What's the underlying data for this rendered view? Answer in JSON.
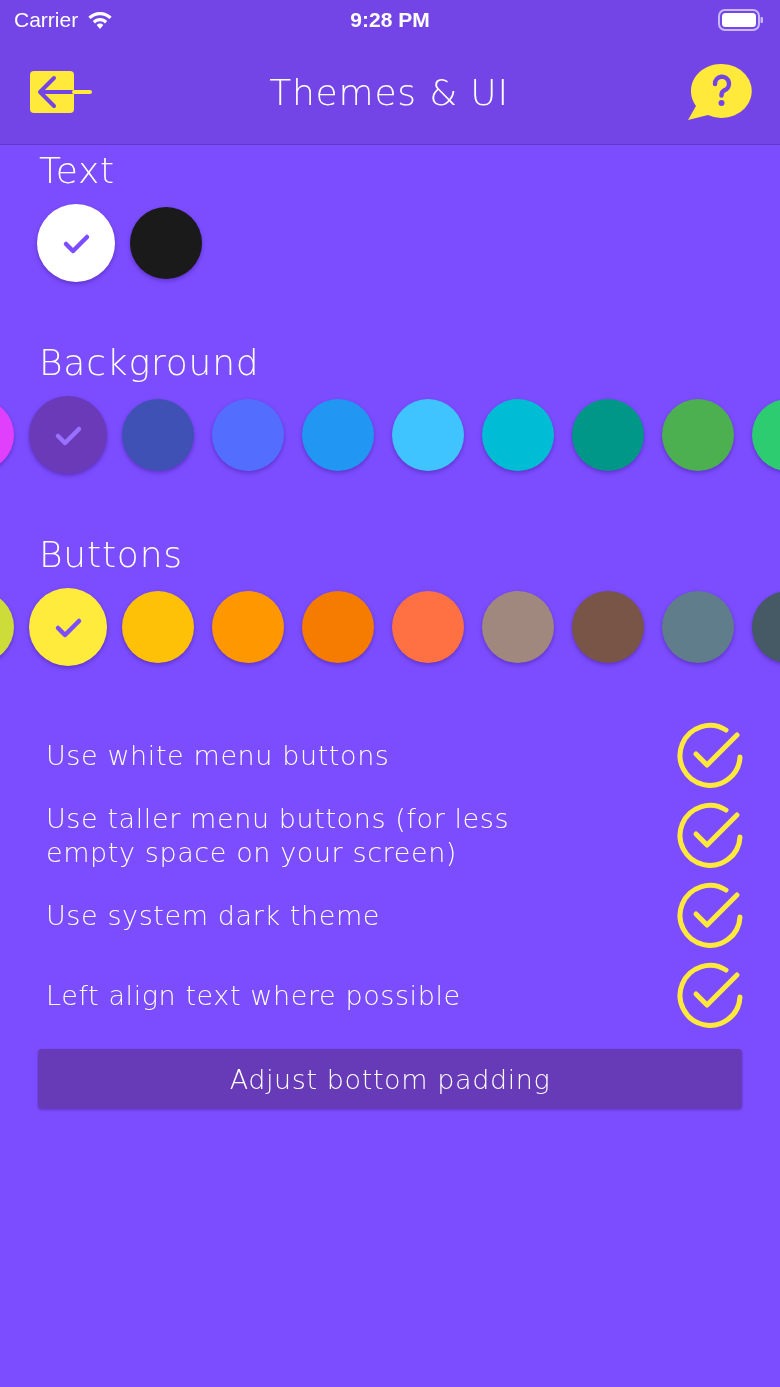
{
  "status_bar": {
    "carrier": "Carrier",
    "time": "9:28 PM"
  },
  "nav": {
    "title": "Themes & UI"
  },
  "palettes": [
    {
      "label": "Text",
      "swatches": [
        {
          "color": "#ffffff",
          "selected": true
        },
        {
          "color": "#1a1a1a",
          "selected": false
        }
      ]
    },
    {
      "label": "Background",
      "swatches": [
        {
          "color": "#e040fb",
          "selected": false
        },
        {
          "color": "#6a3ab8",
          "selected": true
        },
        {
          "color": "#3f51b5",
          "selected": false
        },
        {
          "color": "#536dfe",
          "selected": false
        },
        {
          "color": "#2196f3",
          "selected": false
        },
        {
          "color": "#40c4ff",
          "selected": false
        },
        {
          "color": "#00bcd4",
          "selected": false
        },
        {
          "color": "#009688",
          "selected": false
        },
        {
          "color": "#4caf50",
          "selected": false
        },
        {
          "color": "#2ecc71",
          "selected": false
        }
      ]
    },
    {
      "label": "Buttons",
      "swatches": [
        {
          "color": "#cddc39",
          "selected": false
        },
        {
          "color": "#ffeb3b",
          "selected": true
        },
        {
          "color": "#ffc107",
          "selected": false
        },
        {
          "color": "#ff9800",
          "selected": false
        },
        {
          "color": "#f57c00",
          "selected": false
        },
        {
          "color": "#ff7043",
          "selected": false
        },
        {
          "color": "#a1887f",
          "selected": false
        },
        {
          "color": "#795548",
          "selected": false
        },
        {
          "color": "#607d8b",
          "selected": false
        },
        {
          "color": "#455a64",
          "selected": false
        }
      ]
    }
  ],
  "options": [
    {
      "label": "Use white menu buttons",
      "checked": true
    },
    {
      "label": "Use taller menu buttons (for less empty space on your screen)",
      "checked": true
    },
    {
      "label": "Use system dark theme",
      "checked": true
    },
    {
      "label": "Left align text where possible",
      "checked": true
    }
  ],
  "action_button": "Adjust bottom padding"
}
